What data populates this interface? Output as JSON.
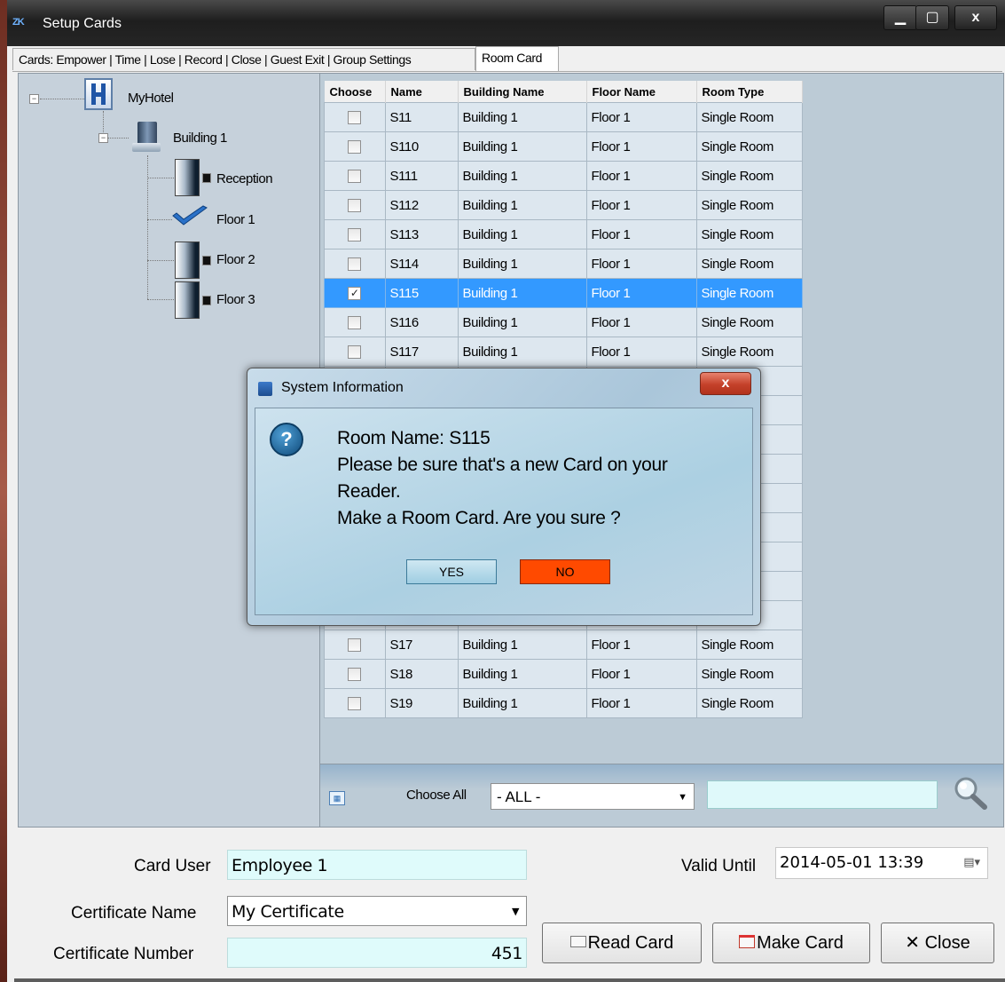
{
  "window": {
    "logo": "ZK",
    "title": "Setup Cards",
    "controls": {
      "minimize": "▁",
      "maximize": "▢",
      "close": "x"
    }
  },
  "tabs": [
    {
      "label": "Cards: Empower | Time | Lose | Record | Close | Guest Exit | Group Settings"
    },
    {
      "label": "Room Card"
    }
  ],
  "tree": {
    "root": "MyHotel",
    "building": "Building 1",
    "children": [
      "Reception",
      "Floor 1",
      "Floor 2",
      "Floor 3"
    ]
  },
  "grid": {
    "columns": [
      "Choose",
      "Name",
      "Building Name",
      "Floor Name",
      "Room Type"
    ],
    "rows": [
      {
        "checked": false,
        "name": "S11",
        "building": "Building 1",
        "floor": "Floor 1",
        "type": "Single Room"
      },
      {
        "checked": false,
        "name": "S110",
        "building": "Building 1",
        "floor": "Floor 1",
        "type": "Single Room"
      },
      {
        "checked": false,
        "name": "S111",
        "building": "Building 1",
        "floor": "Floor 1",
        "type": "Single Room"
      },
      {
        "checked": false,
        "name": "S112",
        "building": "Building 1",
        "floor": "Floor 1",
        "type": "Single Room"
      },
      {
        "checked": false,
        "name": "S113",
        "building": "Building 1",
        "floor": "Floor 1",
        "type": "Single Room"
      },
      {
        "checked": false,
        "name": "S114",
        "building": "Building 1",
        "floor": "Floor 1",
        "type": "Single Room"
      },
      {
        "checked": true,
        "name": "S115",
        "building": "Building 1",
        "floor": "Floor 1",
        "type": "Single Room"
      },
      {
        "checked": false,
        "name": "S116",
        "building": "Building 1",
        "floor": "Floor 1",
        "type": "Single Room"
      },
      {
        "checked": false,
        "name": "S117",
        "building": "Building 1",
        "floor": "Floor 1",
        "type": "Single Room"
      },
      {
        "checked": false,
        "name": "",
        "building": "",
        "floor": "",
        "type": ""
      },
      {
        "checked": false,
        "name": "",
        "building": "",
        "floor": "",
        "type": ""
      },
      {
        "checked": false,
        "name": "",
        "building": "",
        "floor": "",
        "type": ""
      },
      {
        "checked": false,
        "name": "",
        "building": "",
        "floor": "",
        "type": ""
      },
      {
        "checked": false,
        "name": "",
        "building": "",
        "floor": "",
        "type": ""
      },
      {
        "checked": false,
        "name": "",
        "building": "",
        "floor": "",
        "type": ""
      },
      {
        "checked": false,
        "name": "",
        "building": "",
        "floor": "",
        "type": ""
      },
      {
        "checked": false,
        "name": "",
        "building": "",
        "floor": "",
        "type": ""
      },
      {
        "checked": false,
        "name": "",
        "building": "",
        "floor": "",
        "type": ""
      },
      {
        "checked": false,
        "name": "S17",
        "building": "Building 1",
        "floor": "Floor 1",
        "type": "Single Room"
      },
      {
        "checked": false,
        "name": "S18",
        "building": "Building 1",
        "floor": "Floor 1",
        "type": "Single Room"
      },
      {
        "checked": false,
        "name": "S19",
        "building": "Building 1",
        "floor": "Floor 1",
        "type": "Single Room"
      }
    ],
    "selected_row_color": "#3399ff"
  },
  "footer": {
    "choose_all_label": "Choose All",
    "filter_value": "- ALL -",
    "search_value": ""
  },
  "form": {
    "card_user_label": "Card User",
    "card_user_value": "Employee 1",
    "certificate_name_label": "Certificate Name",
    "certificate_name_value": "My Certificate",
    "certificate_number_label": "Certificate Number",
    "certificate_number_value": "451",
    "valid_until_label": "Valid Until",
    "valid_until_value": "2014-05-01 13:39"
  },
  "buttons": {
    "read_card": "Read Card",
    "make_card": "Make Card",
    "close": "✕ Close"
  },
  "dialog": {
    "title": "System Information",
    "close": "x",
    "lines": [
      "Room Name: S115",
      "Please be sure that's a new Card on your",
      "Reader.",
      "Make a Room Card. Are you sure ?"
    ],
    "yes": "YES",
    "no": "NO",
    "no_color": "#ff4a00"
  }
}
